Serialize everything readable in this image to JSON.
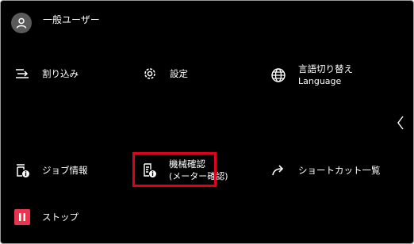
{
  "user": {
    "name": "一般ユーザー",
    "icon": "user-icon"
  },
  "menu": {
    "interrupt": {
      "label": "割り込み",
      "icon": "interrupt-icon"
    },
    "settings": {
      "label": "設定",
      "icon": "gear-icon"
    },
    "language": {
      "label": "言語切り替え",
      "sub": "Language",
      "icon": "globe-icon"
    },
    "job_info": {
      "label": "ジョブ情報",
      "icon": "job-info-icon"
    },
    "machine_check": {
      "label": "機械確認",
      "sub": "(メーター確認)",
      "icon": "machine-info-icon"
    },
    "shortcut_list": {
      "label": "ショートカット一覧",
      "icon": "share-arrow-icon"
    },
    "stop": {
      "label": "ストップ",
      "icon": "stop-icon"
    }
  },
  "colors": {
    "background": "#000000",
    "highlight": "#e0001b",
    "stop": "#e8344d",
    "avatar": "#5a5a5a"
  }
}
